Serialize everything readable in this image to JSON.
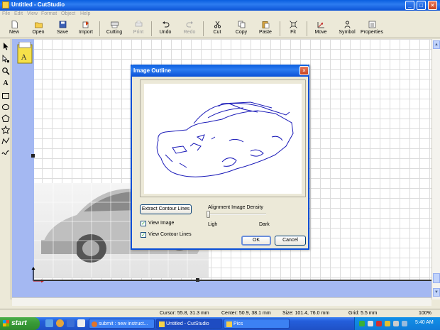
{
  "window": {
    "title": "Untitled - CutStudio",
    "controls": {
      "minimize": "_",
      "maximize": "□",
      "close": "×"
    }
  },
  "menu": [
    "File",
    "Edit",
    "View",
    "Format",
    "Object",
    "Help"
  ],
  "toolbar": {
    "new": "New",
    "open": "Open",
    "save": "Save",
    "import": "Import",
    "cutting": "Cutting",
    "print": "Print",
    "undo": "Undo",
    "redo": "Redo",
    "cut": "Cut",
    "copy": "Copy",
    "paste": "Paste",
    "fit": "Fit",
    "move": "Move",
    "symbol": "Symbol",
    "properties": "Properties"
  },
  "dialog": {
    "title": "Image Outline",
    "close": "×",
    "extract_button": "Extract Contour Lines",
    "density_label": "Alignment Image Density",
    "density_value": 0,
    "light_label": "Ligh",
    "dark_label": "Dark",
    "view_image": {
      "label": "View Image",
      "checked": true,
      "mark": "✓"
    },
    "view_contour": {
      "label": "View Contour Lines",
      "checked": true,
      "mark": "✓"
    },
    "ok": "OK",
    "cancel": "Cancel"
  },
  "status": {
    "cursor": "Cursor: 55.8, 31.3 mm",
    "center": "Center: 50.9, 38.1 mm",
    "size": "Size: 101.4, 76.0 mm",
    "grid": "Grid: 5.5 mm",
    "zoom": "100%"
  },
  "taskbar": {
    "start": "start",
    "tasks": [
      "submit : new instruct...",
      "Untitled - CutStudio",
      "Pics"
    ],
    "clock": "5:40 AM"
  },
  "colors": {
    "xp_blue": "#0a5ee0",
    "start_green": "#3a9c38",
    "contour_blue": "#1a1ab8",
    "canvas_margin": "#a4b8f2"
  }
}
